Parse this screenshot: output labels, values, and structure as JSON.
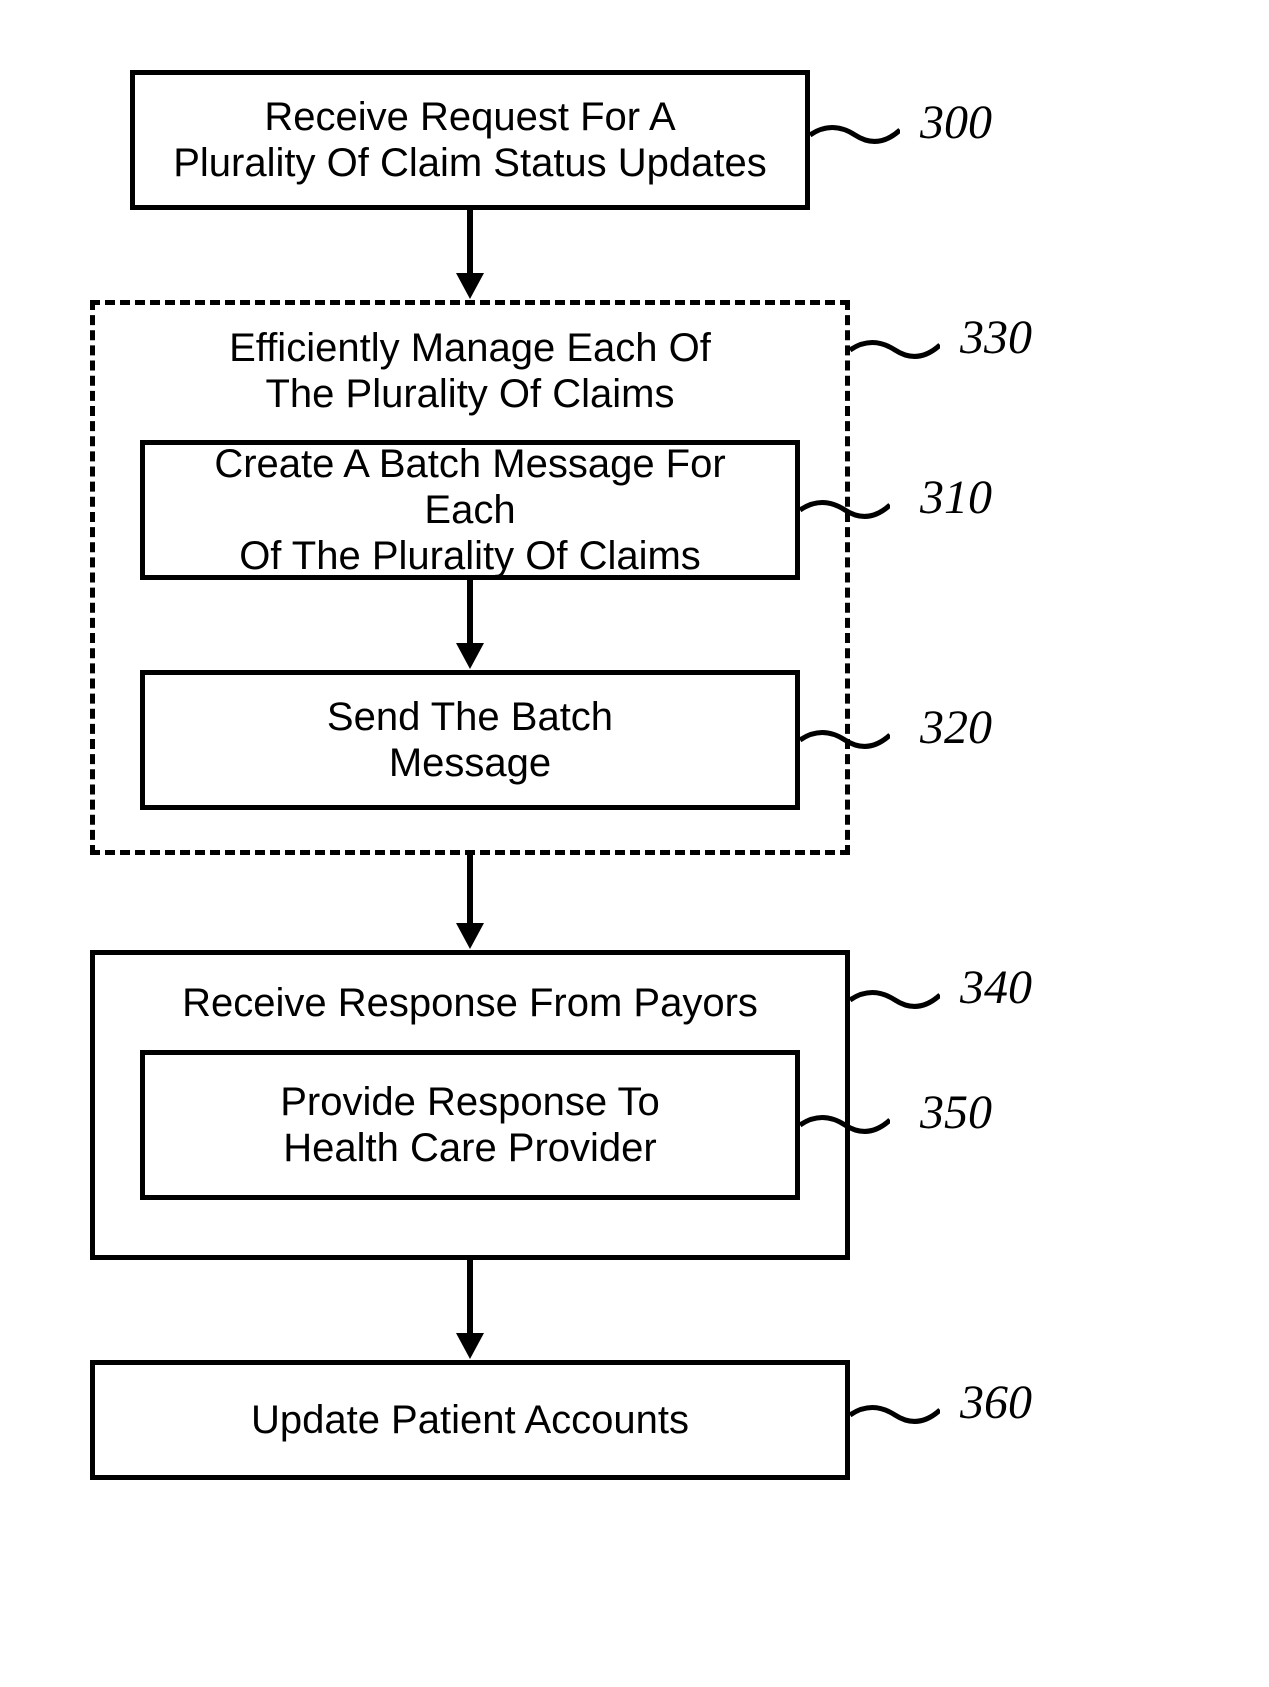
{
  "boxes": {
    "receive_request": {
      "line1": "Receive Request For A",
      "line2": "Plurality Of Claim Status Updates"
    },
    "manage": {
      "line1": "Efficiently Manage Each Of",
      "line2": "The Plurality Of Claims"
    },
    "create_batch": {
      "line1": "Create A Batch Message For Each",
      "line2": "Of The Plurality Of Claims"
    },
    "send_batch": {
      "line1": "Send The Batch",
      "line2": "Message"
    },
    "receive_response": {
      "title": "Receive Response From Payors"
    },
    "provide_response": {
      "line1": "Provide Response To",
      "line2": "Health Care Provider"
    },
    "update_accounts": {
      "text": "Update Patient Accounts"
    }
  },
  "labels": {
    "l300": "300",
    "l330": "330",
    "l310": "310",
    "l320": "320",
    "l340": "340",
    "l350": "350",
    "l360": "360"
  }
}
